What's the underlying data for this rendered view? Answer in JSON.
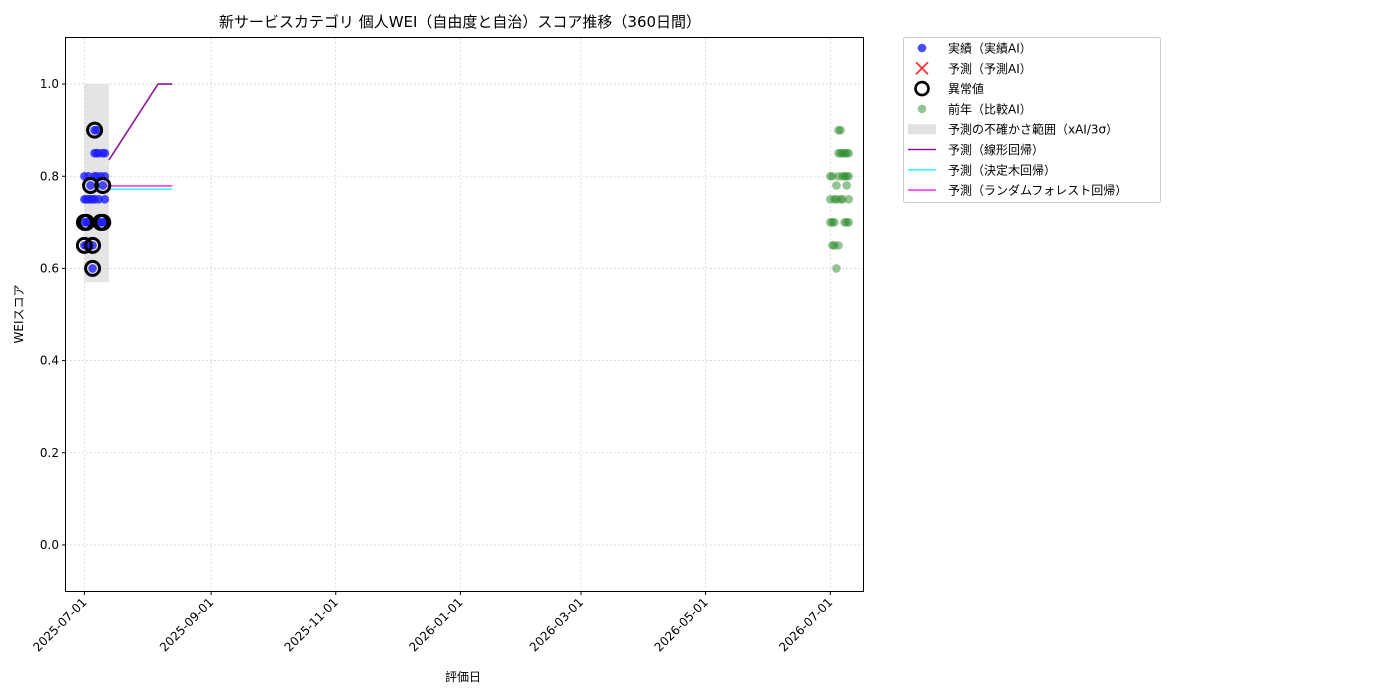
{
  "chart_data": {
    "type": "scatter",
    "title": "新サービスカテゴリ 個人WEI（自由度と自治）スコア推移（360日間）",
    "xlabel": "評価日",
    "ylabel": "WEIスコア",
    "xlim": [
      "2025-06-22",
      "2026-07-17"
    ],
    "ylim": [
      -0.1,
      1.1
    ],
    "y_ticks": [
      "0.0",
      "0.2",
      "0.4",
      "0.6",
      "0.8",
      "1.0"
    ],
    "x_ticks": [
      "2025-07-01",
      "2025-09-01",
      "2025-11-01",
      "2026-01-01",
      "2026-03-01",
      "2026-05-01",
      "2026-07-01"
    ],
    "grid": true,
    "legend_position": "outside-top-right",
    "legend": [
      "実績（実績AI）",
      "予測（予測AI）",
      "異常値",
      "前年（比較AI）",
      "予測の不確かさ範囲（xAI/3σ）",
      "予測（線形回帰）",
      "予測（決定木回帰）",
      "予測（ランダムフォレスト回帰）"
    ],
    "colors": {
      "actual": "#1f1fff",
      "predicted": "#ff3333",
      "anomaly": "#000000",
      "previous_year": "#2a8a2a",
      "uncertainty": "#d9d9d9",
      "linear": "#8b1a9a",
      "tree": "#33ffff",
      "forest": "#ff33ff"
    },
    "series": [
      {
        "name": "実績（実績AI）",
        "kind": "scatter",
        "points": [
          [
            "2025-07-01",
            0.8
          ],
          [
            "2025-07-01",
            0.75
          ],
          [
            "2025-07-01",
            0.7
          ],
          [
            "2025-07-01",
            0.65
          ],
          [
            "2025-07-02",
            0.7
          ],
          [
            "2025-07-02",
            0.65
          ],
          [
            "2025-07-02",
            0.75
          ],
          [
            "2025-07-03",
            0.8
          ],
          [
            "2025-07-03",
            0.75
          ],
          [
            "2025-07-03",
            0.7
          ],
          [
            "2025-07-03",
            0.65
          ],
          [
            "2025-07-04",
            0.78
          ],
          [
            "2025-07-04",
            0.75
          ],
          [
            "2025-07-05",
            0.65
          ],
          [
            "2025-07-05",
            0.6
          ],
          [
            "2025-07-05",
            0.75
          ],
          [
            "2025-07-06",
            0.9
          ],
          [
            "2025-07-06",
            0.85
          ],
          [
            "2025-07-06",
            0.8
          ],
          [
            "2025-07-06",
            0.75
          ],
          [
            "2025-07-07",
            0.85
          ],
          [
            "2025-07-07",
            0.8
          ],
          [
            "2025-07-07",
            0.9
          ],
          [
            "2025-07-08",
            0.85
          ],
          [
            "2025-07-08",
            0.75
          ],
          [
            "2025-07-08",
            0.7
          ],
          [
            "2025-07-09",
            0.8
          ],
          [
            "2025-07-09",
            0.7
          ],
          [
            "2025-07-10",
            0.85
          ],
          [
            "2025-07-10",
            0.78
          ],
          [
            "2025-07-10",
            0.7
          ],
          [
            "2025-07-11",
            0.85
          ],
          [
            "2025-07-11",
            0.8
          ],
          [
            "2025-07-11",
            0.75
          ],
          [
            "2025-07-11",
            0.7
          ]
        ]
      },
      {
        "name": "異常値",
        "kind": "anomaly",
        "points": [
          [
            "2025-07-01",
            0.7
          ],
          [
            "2025-07-01",
            0.65
          ],
          [
            "2025-07-02",
            0.7
          ],
          [
            "2025-07-04",
            0.78
          ],
          [
            "2025-07-05",
            0.65
          ],
          [
            "2025-07-05",
            0.6
          ],
          [
            "2025-07-06",
            0.9
          ],
          [
            "2025-07-09",
            0.7
          ],
          [
            "2025-07-10",
            0.78
          ],
          [
            "2025-07-10",
            0.7
          ]
        ]
      },
      {
        "name": "前年（比較AI）",
        "kind": "scatter",
        "points": [
          [
            "2026-07-01",
            0.8
          ],
          [
            "2026-07-01",
            0.75
          ],
          [
            "2026-07-01",
            0.7
          ],
          [
            "2026-07-02",
            0.65
          ],
          [
            "2026-07-02",
            0.7
          ],
          [
            "2026-07-02",
            0.8
          ],
          [
            "2026-07-03",
            0.75
          ],
          [
            "2026-07-03",
            0.7
          ],
          [
            "2026-07-03",
            0.65
          ],
          [
            "2026-07-04",
            0.78
          ],
          [
            "2026-07-04",
            0.75
          ],
          [
            "2026-07-04",
            0.6
          ],
          [
            "2026-07-05",
            0.9
          ],
          [
            "2026-07-05",
            0.85
          ],
          [
            "2026-07-05",
            0.8
          ],
          [
            "2026-07-05",
            0.65
          ],
          [
            "2026-07-06",
            0.9
          ],
          [
            "2026-07-06",
            0.85
          ],
          [
            "2026-07-06",
            0.75
          ],
          [
            "2026-07-07",
            0.85
          ],
          [
            "2026-07-07",
            0.8
          ],
          [
            "2026-07-07",
            0.75
          ],
          [
            "2026-07-08",
            0.85
          ],
          [
            "2026-07-08",
            0.8
          ],
          [
            "2026-07-08",
            0.7
          ],
          [
            "2026-07-09",
            0.85
          ],
          [
            "2026-07-09",
            0.8
          ],
          [
            "2026-07-09",
            0.78
          ],
          [
            "2026-07-09",
            0.7
          ],
          [
            "2026-07-10",
            0.85
          ],
          [
            "2026-07-10",
            0.8
          ],
          [
            "2026-07-10",
            0.75
          ],
          [
            "2026-07-10",
            0.7
          ]
        ]
      },
      {
        "name": "予測の不確かさ範囲（xAI/3σ）",
        "kind": "band",
        "x_start": "2025-07-01",
        "x_end": "2025-07-13",
        "y_low": 0.57,
        "y_high": 1.0
      },
      {
        "name": "予測（線形回帰）",
        "kind": "line",
        "points": [
          [
            "2025-07-13",
            0.835
          ],
          [
            "2025-08-06",
            1.0
          ],
          [
            "2025-08-13",
            1.0
          ]
        ]
      },
      {
        "name": "予測（決定木回帰）",
        "kind": "line",
        "points": [
          [
            "2025-07-12",
            0.772
          ],
          [
            "2025-08-13",
            0.772
          ]
        ]
      },
      {
        "name": "予測（ランダムフォレスト回帰）",
        "kind": "line",
        "points": [
          [
            "2025-07-12",
            0.779
          ],
          [
            "2025-08-13",
            0.779
          ]
        ]
      }
    ]
  }
}
